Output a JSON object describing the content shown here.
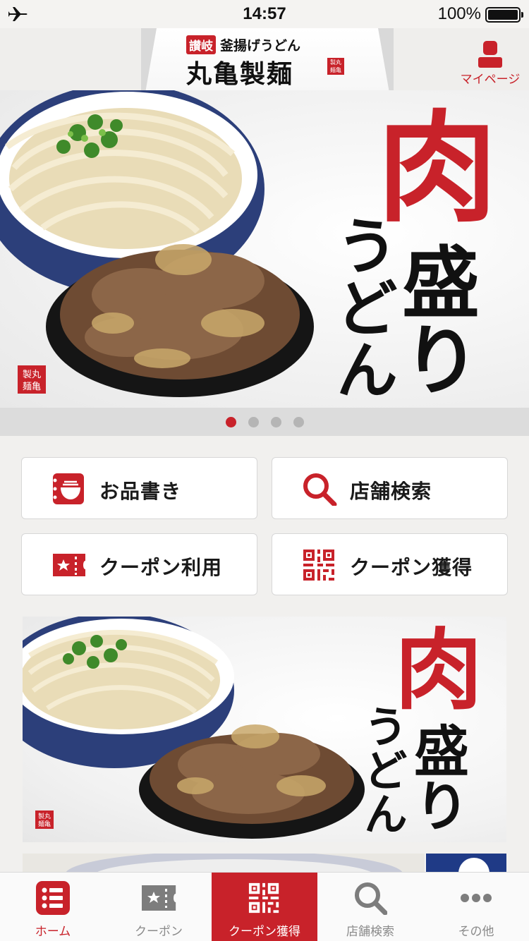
{
  "status_bar": {
    "time": "14:57",
    "battery": "100%"
  },
  "header": {
    "sub_tag": "讃岐",
    "sub_title": "釜揚げうどん",
    "brand": "丸亀製麺",
    "stamp": "丸亀製麺",
    "mypage_label": "マイページ"
  },
  "hero": {
    "title_red": "肉",
    "title_line2": "盛り",
    "title_line3": "うどん",
    "slides_total": 4,
    "active_slide": 1
  },
  "actions": [
    {
      "label": "お品書き",
      "icon": "menu-bowl-icon"
    },
    {
      "label": "店舗検索",
      "icon": "search-icon"
    },
    {
      "label": "クーポン利用",
      "icon": "coupon-ticket-icon"
    },
    {
      "label": "クーポン獲得",
      "icon": "qr-code-icon"
    }
  ],
  "banner": {
    "title_red": "肉",
    "title_line2": "盛り",
    "title_line3": "うどん"
  },
  "tabs": [
    {
      "label": "ホーム",
      "icon": "home-list-icon"
    },
    {
      "label": "クーポン",
      "icon": "coupon-ticket-icon"
    },
    {
      "label": "クーポン獲得",
      "icon": "qr-code-icon"
    },
    {
      "label": "店舗検索",
      "icon": "search-icon"
    },
    {
      "label": "その他",
      "icon": "more-dots-icon"
    }
  ],
  "colors": {
    "brand_red": "#c8222a",
    "tab_inactive": "#8a8a8a"
  }
}
